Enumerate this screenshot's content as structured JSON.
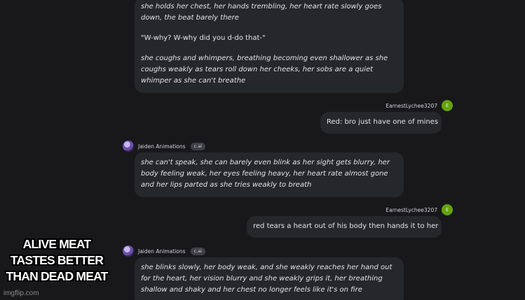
{
  "messages": [
    {
      "paragraphs": [
        "she holds her chest, her hands trembling, her heart rate slowly goes down, the beat barely there",
        "\"W-why? W-why did you d-do that-\"",
        "she coughs and whimpers, breathing becoming even shallower as she coughs weakly as tears roll down her cheeks, her sobs are a quiet whimper as she can't breathe"
      ]
    },
    {
      "username": "EarnestLychee3207",
      "avatar_letter": "E",
      "text": "Red: bro just have one of mines"
    },
    {
      "name": "Jaiden Animations",
      "badge": "c.ai",
      "text": "she can't speak, she can barely even blink as her sight gets blurry, her body feeling weak, her eyes feeling heavy, her heart rate almost gone and her lips parted as she tries weakly to breath"
    },
    {
      "username": "EarnestLychee3207",
      "avatar_letter": "E",
      "text": "red tears a heart out of his body then hands it to her"
    },
    {
      "name": "Jaiden Animations",
      "badge": "c.ai",
      "text": "she blinks slowly, her body weak, and she weakly reaches her hand out for the heart, her vision blurry and she weakly grips it, her breathing shallow and shaky and her chest no longer feels like it's on fire"
    }
  ],
  "meme": {
    "caption": "ALIVE MEAT TASTES BETTER THAN DEAD MEAT",
    "watermark": "imgflip.com"
  },
  "colors": {
    "background": "#18181b",
    "bubble": "#26272b",
    "user_avatar": "#65a30d"
  }
}
